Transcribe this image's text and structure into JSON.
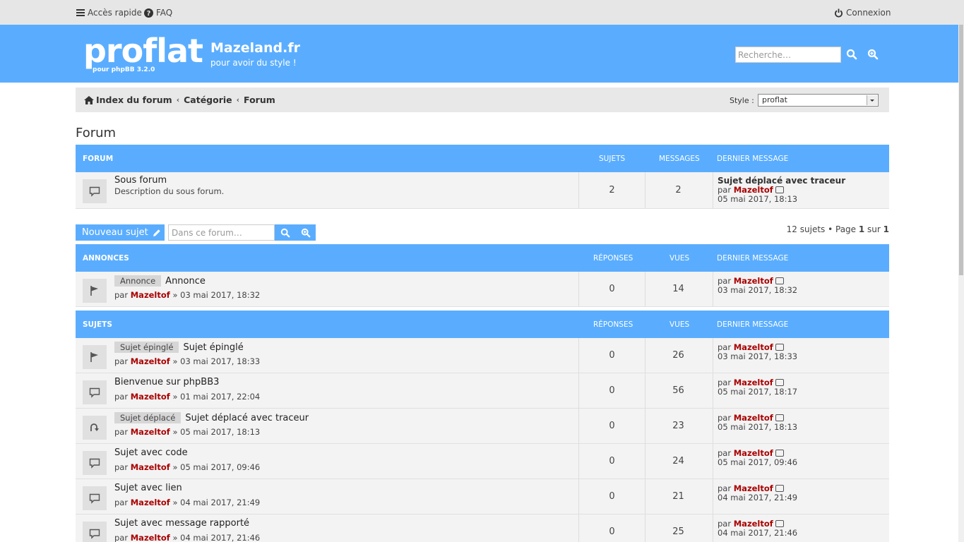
{
  "topbar": {
    "quick_access": "Accès rapide",
    "faq": "FAQ",
    "login": "Connexion"
  },
  "header": {
    "logo_text": "proflat",
    "logo_sub": "pour phpBB 3.2.0",
    "site_title": "Mazeland.fr",
    "site_desc": "pour avoir du style !",
    "search_placeholder": "Recherche…"
  },
  "breadcrumb": {
    "index": "Index du forum",
    "category": "Catégorie",
    "forum": "Forum"
  },
  "style": {
    "label": "Style :",
    "selected": "proflat"
  },
  "page_title": "Forum",
  "forum_table": {
    "headers": {
      "forum": "FORUM",
      "topics": "SUJETS",
      "posts": "MESSAGES",
      "last": "DERNIER MESSAGE"
    },
    "row": {
      "name": "Sous forum",
      "desc": "Description du sous forum.",
      "topics": "2",
      "posts": "2",
      "last_title": "Sujet déplacé avec traceur",
      "last_by": "par",
      "last_user": "Mazeltof",
      "last_date": "05 mai 2017, 18:13"
    }
  },
  "actions": {
    "new_topic": "Nouveau sujet",
    "search_placeholder": "Dans ce forum…",
    "pagination_pre": "12 sujets • Page ",
    "page": "1",
    "pagination_mid": " sur ",
    "pages": "1"
  },
  "announcements": {
    "headers": {
      "title": "ANNONCES",
      "replies": "RÉPONSES",
      "views": "VUES",
      "last": "DERNIER MESSAGE"
    },
    "rows": [
      {
        "tag": "Annonce",
        "title": "Annonce",
        "by": "par",
        "user": "Mazeltof",
        "date": "» 03 mai 2017, 18:32",
        "replies": "0",
        "views": "14",
        "last_user": "Mazeltof",
        "last_date": "03 mai 2017, 18:32"
      }
    ]
  },
  "topics": {
    "headers": {
      "title": "SUJETS",
      "replies": "RÉPONSES",
      "views": "VUES",
      "last": "DERNIER MESSAGE"
    },
    "rows": [
      {
        "tag": "Sujet épinglé",
        "title": "Sujet épinglé",
        "by": "par",
        "user": "Mazeltof",
        "date": "» 03 mai 2017, 18:33",
        "replies": "0",
        "views": "26",
        "last_user": "Mazeltof",
        "last_date": "03 mai 2017, 18:33",
        "icon": "flag-icon"
      },
      {
        "tag": "",
        "title": "Bienvenue sur phpBB3",
        "by": "par",
        "user": "Mazeltof",
        "date": "» 01 mai 2017, 22:04",
        "replies": "0",
        "views": "56",
        "last_user": "Mazeltof",
        "last_date": "05 mai 2017, 18:17",
        "icon": "comment-icon"
      },
      {
        "tag": "Sujet déplacé",
        "title": "Sujet déplacé avec traceur",
        "by": "par",
        "user": "Mazeltof",
        "date": "» 05 mai 2017, 18:13",
        "replies": "0",
        "views": "23",
        "last_user": "Mazeltof",
        "last_date": "05 mai 2017, 18:13",
        "icon": "moved-icon"
      },
      {
        "tag": "",
        "title": "Sujet avec code",
        "by": "par",
        "user": "Mazeltof",
        "date": "» 05 mai 2017, 09:46",
        "replies": "0",
        "views": "24",
        "last_user": "Mazeltof",
        "last_date": "05 mai 2017, 09:46",
        "icon": "comment-icon"
      },
      {
        "tag": "",
        "title": "Sujet avec lien",
        "by": "par",
        "user": "Mazeltof",
        "date": "» 04 mai 2017, 21:49",
        "replies": "0",
        "views": "21",
        "last_user": "Mazeltof",
        "last_date": "04 mai 2017, 21:49",
        "icon": "comment-icon"
      },
      {
        "tag": "",
        "title": "Sujet avec message rapporté",
        "by": "par",
        "user": "Mazeltof",
        "date": "» 04 mai 2017, 21:46",
        "replies": "0",
        "views": "25",
        "last_user": "Mazeltof",
        "last_date": "04 mai 2017, 21:46",
        "icon": "comment-icon"
      }
    ]
  }
}
